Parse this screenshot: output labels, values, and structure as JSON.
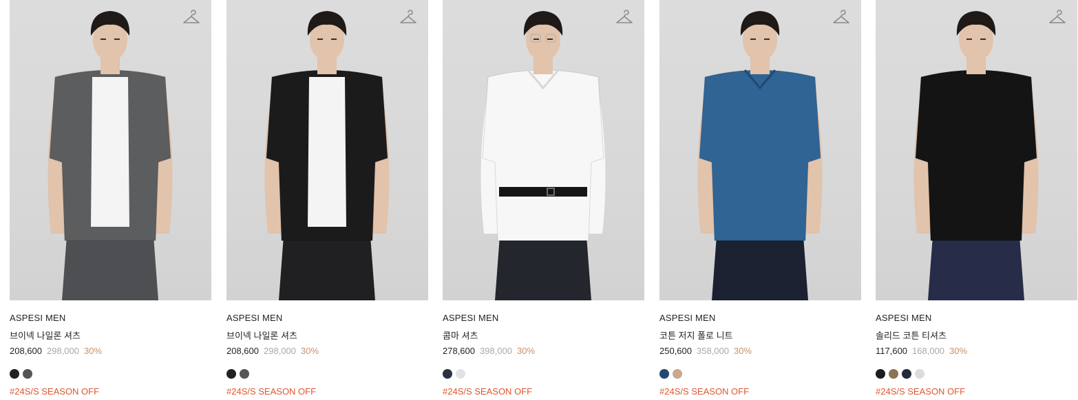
{
  "products": [
    {
      "brand": "ASPESI MEN",
      "name": "브이넥 나일론 셔츠",
      "price": "208,600",
      "original_price": "298,000",
      "discount": "30%",
      "swatches": [
        "#222222",
        "#555555"
      ],
      "tag": "#24S/S SEASON OFF",
      "shirt_color": "#5b5d5f",
      "pants_color": "#4d4f52",
      "inner_color": "#f4f4f4"
    },
    {
      "brand": "ASPESI MEN",
      "name": "브이넥 나일론 셔츠",
      "price": "208,600",
      "original_price": "298,000",
      "discount": "30%",
      "swatches": [
        "#222222",
        "#555555"
      ],
      "tag": "#24S/S SEASON OFF",
      "shirt_color": "#1b1b1c",
      "pants_color": "#202022",
      "inner_color": "#f4f4f4"
    },
    {
      "brand": "ASPESI MEN",
      "name": "콤마 셔츠",
      "price": "278,600",
      "original_price": "398,000",
      "discount": "30%",
      "swatches": [
        "#2a3142",
        "#e3e3e6"
      ],
      "tag": "#24S/S SEASON OFF",
      "shirt_color": "#f7f7f7",
      "pants_color": "#23262c",
      "inner_color": "#f7f7f7"
    },
    {
      "brand": "ASPESI MEN",
      "name": "코튼 저지 폴로 니트",
      "price": "250,600",
      "original_price": "358,000",
      "discount": "30%",
      "swatches": [
        "#234873",
        "#c9a88f"
      ],
      "tag": "#24S/S SEASON OFF",
      "shirt_color": "#2f6494",
      "pants_color": "#1b2130",
      "inner_color": "#2f6494"
    },
    {
      "brand": "ASPESI MEN",
      "name": "솔리드 코튼 티셔츠",
      "price": "117,600",
      "original_price": "168,000",
      "discount": "30%",
      "swatches": [
        "#1c1c1c",
        "#8a7453",
        "#232a3a",
        "#dcdce0"
      ],
      "tag": "#24S/S SEASON OFF",
      "shirt_color": "#141414",
      "pants_color": "#272c48",
      "inner_color": "#141414"
    }
  ],
  "icons": {
    "wishlist": "hanger-icon"
  }
}
